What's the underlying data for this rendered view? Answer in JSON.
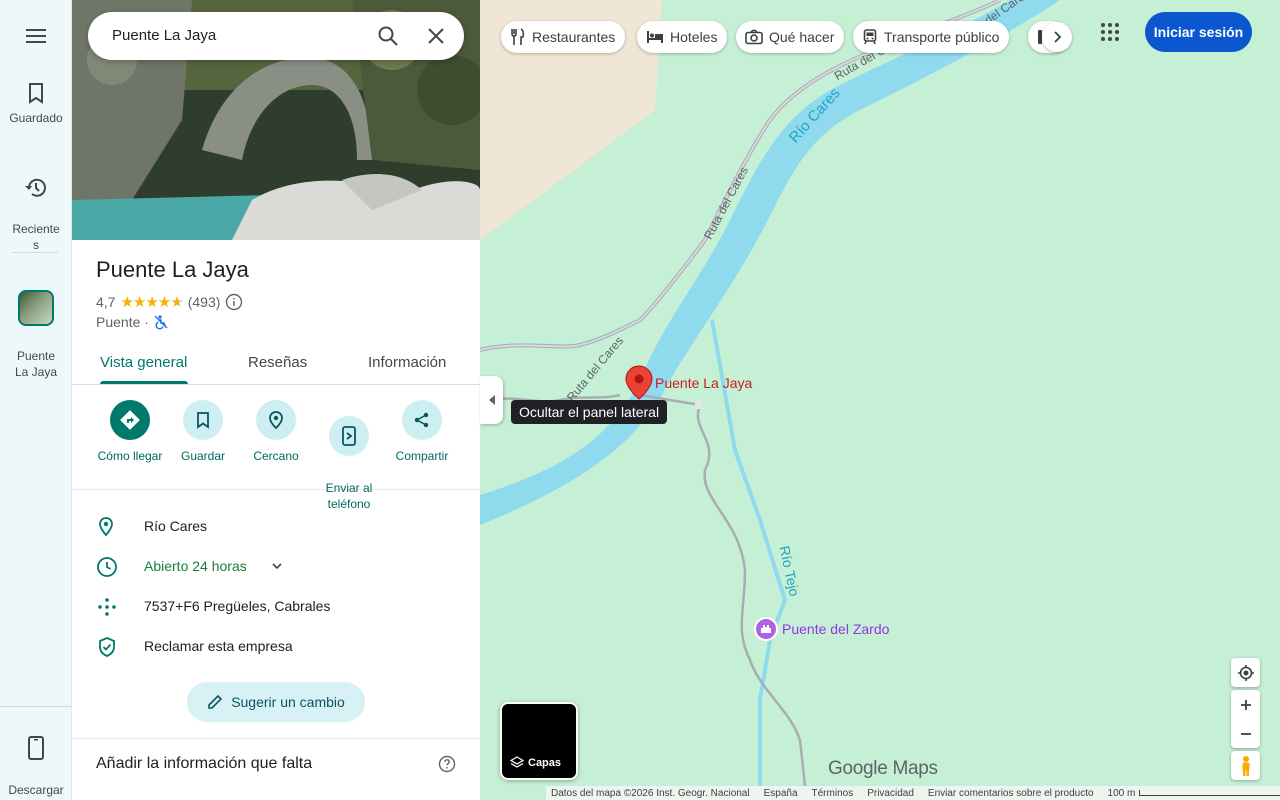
{
  "search": {
    "query": "Puente La Jaya"
  },
  "rail": {
    "menu_label": "",
    "items": [
      {
        "label": "Guardado",
        "icon": "bookmark-icon"
      },
      {
        "label": "Reciente\ns",
        "icon": "history-icon"
      },
      {
        "label": "Puente\nLa Jaya",
        "icon": "place-thumbnail"
      }
    ],
    "download_label": "Descargar\naplicación"
  },
  "place": {
    "name": "Puente La Jaya",
    "rating": "4,7",
    "reviews": "(493)",
    "category": "Puente ·"
  },
  "tabs": [
    "Vista general",
    "Reseñas",
    "Información"
  ],
  "actions": [
    "Cómo llegar",
    "Guardar",
    "Cercano",
    "Enviar al\nteléfono",
    "Compartir"
  ],
  "info": {
    "address": "Río Cares",
    "hours": "Abierto 24 horas",
    "pluscode": "7537+F6 Pregüeles, Cabrales",
    "claim": "Reclamar esta empresa"
  },
  "suggest_label": "Sugerir un cambio",
  "missing_title": "Añadir la información que falta",
  "tooltip": "Ocultar el panel lateral",
  "chips": [
    "Restaurantes",
    "Hoteles",
    "Qué hacer",
    "Transporte público"
  ],
  "signin": "Iniciar sesión",
  "layers_label": "Capas",
  "map_labels": {
    "river1": "Río Cares",
    "river2": "Río Tejo",
    "road1": "Ruta del Cares",
    "road2": "Ruta del Cares",
    "road3": "Ruta del Cares",
    "road4": "Ruta del Cares",
    "pin": "Puente La Jaya",
    "poi": "Puente del Zardo"
  },
  "logo": "Google Maps",
  "footer": {
    "data": "Datos del mapa ©2026 Inst. Geogr. Nacional",
    "country": "España",
    "terms": "Términos",
    "privacy": "Privacidad",
    "feedback": "Enviar comentarios sobre el producto",
    "scale": "100 m"
  },
  "colors": {
    "accent": "#00796b",
    "water": "#90daee",
    "park": "#c6f0d5",
    "signin": "#0b57d0"
  }
}
